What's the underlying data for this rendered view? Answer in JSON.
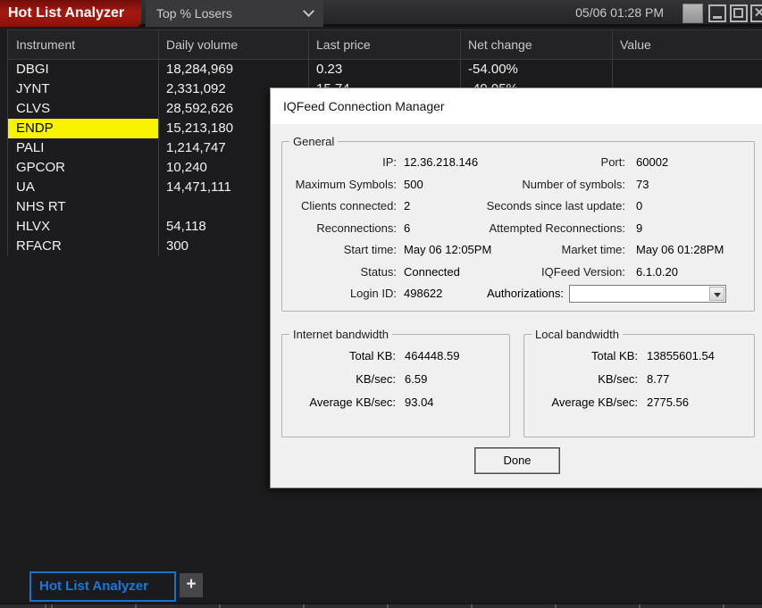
{
  "titlebar": {
    "title": "Hot List Analyzer",
    "list_selector": "Top % Losers",
    "clock": "05/06 01:28 PM"
  },
  "table": {
    "columns": [
      "Instrument",
      "Daily volume",
      "Last price",
      "Net change",
      "Value"
    ],
    "rows": [
      {
        "instrument": "DBGI",
        "daily_volume": "18,284,969",
        "last_price": "0.23",
        "net_change": "-54.00%",
        "value": ""
      },
      {
        "instrument": "JYNT",
        "daily_volume": "2,331,092",
        "last_price": "15.74",
        "net_change": "-49.05%",
        "value": ""
      },
      {
        "instrument": "CLVS",
        "daily_volume": "28,592,626",
        "last_price": "",
        "net_change": "",
        "value": ""
      },
      {
        "instrument": "ENDP",
        "daily_volume": "15,213,180",
        "last_price": "",
        "net_change": "",
        "value": ""
      },
      {
        "instrument": "PALI",
        "daily_volume": "1,214,747",
        "last_price": "",
        "net_change": "",
        "value": ""
      },
      {
        "instrument": "GPCOR",
        "daily_volume": "10,240",
        "last_price": "",
        "net_change": "",
        "value": ""
      },
      {
        "instrument": "UA",
        "daily_volume": "14,471,111",
        "last_price": "",
        "net_change": "",
        "value": ""
      },
      {
        "instrument": "NHS RT",
        "daily_volume": "",
        "last_price": "",
        "net_change": "",
        "value": ""
      },
      {
        "instrument": "HLVX",
        "daily_volume": "54,118",
        "last_price": "",
        "net_change": "",
        "value": ""
      },
      {
        "instrument": "RFACR",
        "daily_volume": "300",
        "last_price": "",
        "net_change": "",
        "value": ""
      }
    ],
    "highlight_color": "#f8f400"
  },
  "dialog": {
    "title": "IQFeed Connection Manager",
    "general": {
      "legend": "General",
      "rows": [
        {
          "l1": "IP:",
          "v1": "12.36.218.146",
          "l2": "Port:",
          "v2": "60002"
        },
        {
          "l1": "Maximum Symbols:",
          "v1": "500",
          "l2": "Number of symbols:",
          "v2": "73"
        },
        {
          "l1": "Clients connected:",
          "v1": "2",
          "l2": "Seconds since last update:",
          "v2": "0"
        },
        {
          "l1": "Reconnections:",
          "v1": "6",
          "l2": "Attempted Reconnections:",
          "v2": "9"
        },
        {
          "l1": "Start time:",
          "v1": "May 06 12:05PM",
          "l2": "Market time:",
          "v2": "May 06 01:28PM"
        },
        {
          "l1": "Status:",
          "v1": "Connected",
          "l2": "IQFeed Version:",
          "v2": "6.1.0.20"
        }
      ],
      "login_label": "Login ID:",
      "login_value": "498622",
      "authorizations_label": "Authorizations:",
      "authorizations_value": ""
    },
    "internet_bandwidth": {
      "legend": "Internet bandwidth",
      "rows": [
        {
          "label": "Total KB:",
          "value": "464448.59"
        },
        {
          "label": "KB/sec:",
          "value": "6.59"
        },
        {
          "label": "Average KB/sec:",
          "value": "93.04"
        }
      ]
    },
    "local_bandwidth": {
      "legend": "Local bandwidth",
      "rows": [
        {
          "label": "Total KB:",
          "value": "13855601.54"
        },
        {
          "label": "KB/sec:",
          "value": "8.77"
        },
        {
          "label": "Average KB/sec:",
          "value": "2775.56"
        }
      ]
    },
    "done_label": "Done"
  },
  "tabs": {
    "active_label": "Hot List Analyzer",
    "add_label": "+",
    "accent_color": "#1473cc"
  }
}
